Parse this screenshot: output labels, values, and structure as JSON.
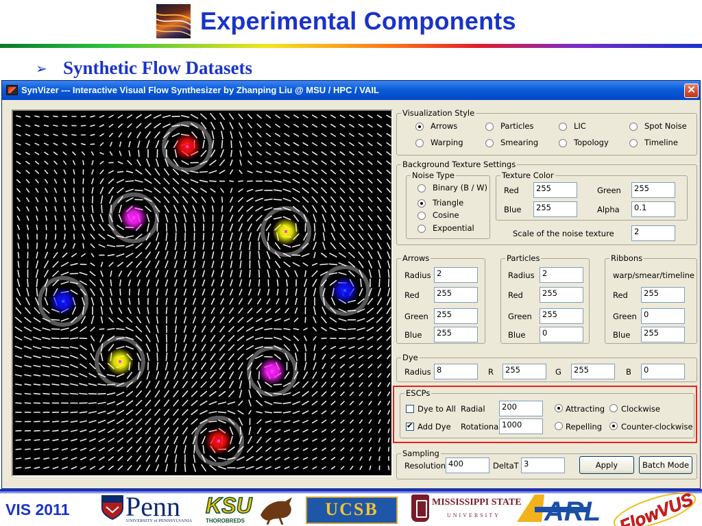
{
  "slide": {
    "title": "Experimental Components",
    "bullet_mark": "➢",
    "bullet_text": "Synthetic Flow Datasets",
    "footer_label": "VIS 2011"
  },
  "window": {
    "title": "SynVizer --- Interactive Visual Flow Synthesizer by Zhanping Liu @ MSU / HPC / VAIL",
    "close_label": "✕"
  },
  "visualization_style": {
    "title": "Visualization Style",
    "options": [
      "Arrows",
      "Particles",
      "LIC",
      "Spot Noise",
      "Warping",
      "Smearing",
      "Topology",
      "Timeline"
    ],
    "selected": "Arrows"
  },
  "background_texture": {
    "title": "Background Texture Settings",
    "noise_type": {
      "title": "Noise Type",
      "options": [
        "Binary (B / W)",
        "Triangle",
        "Cosine",
        "Expoential"
      ],
      "selected": "Triangle"
    },
    "texture_color": {
      "title": "Texture Color",
      "red_label": "Red",
      "red": "255",
      "green_label": "Green",
      "green": "255",
      "blue_label": "Blue",
      "blue": "255",
      "alpha_label": "Alpha",
      "alpha": "0.1"
    },
    "scale_label": "Scale of the noise texture",
    "scale": "2"
  },
  "arrows": {
    "title": "Arrows",
    "radius_label": "Radius",
    "radius": "2",
    "red_label": "Red",
    "red": "255",
    "green_label": "Green",
    "green": "255",
    "blue_label": "Blue",
    "blue": "255"
  },
  "particles": {
    "title": "Particles",
    "radius_label": "Radius",
    "radius": "2",
    "red_label": "Red",
    "red": "255",
    "green_label": "Green",
    "green": "255",
    "blue_label": "Blue",
    "blue": "0"
  },
  "ribbons": {
    "title": "Ribbons",
    "subtitle": "warp/smear/timeline",
    "red_label": "Red",
    "red": "255",
    "green_label": "Green",
    "green": "0",
    "blue_label": "Blue",
    "blue": "255"
  },
  "dye": {
    "title": "Dye",
    "radius_label": "Radius",
    "radius": "8",
    "r_label": "R",
    "r": "255",
    "g_label": "G",
    "g": "255",
    "b_label": "B",
    "b": "0"
  },
  "escps": {
    "title": "ESCPs",
    "dye_to_all_label": "Dye to All",
    "dye_to_all": false,
    "add_dye_label": "Add Dye",
    "add_dye": true,
    "radial_label": "Radial",
    "radial": "200",
    "rotational_label": "Rotational",
    "rotational": "1000",
    "attracting_label": "Attracting",
    "repelling_label": "Repelling",
    "clockwise_label": "Clockwise",
    "counter_clockwise_label": "Counter-clockwise",
    "radial_mode": "Attracting",
    "rotation_mode": "Counter-clockwise",
    "highlight_color": "#e8211b"
  },
  "sampling": {
    "title": "Sampling",
    "resolution_label": "Resolution",
    "resolution": "400",
    "deltat_label": "DeltaT",
    "deltat": "3",
    "apply_label": "Apply",
    "batch_label": "Batch Mode"
  },
  "logos": {
    "penn": "Penn",
    "penn_sub": "UNIVERSITY of PENNSYLVANIA",
    "ksu": "KSU",
    "ksu_sub": "THOROBREDS",
    "ucsb": "UCSB",
    "msu_name": "MISSISSIPPI STATE",
    "msu_uni": "UNIVERSITY",
    "arl": "ARL",
    "flowvus": "FlowVUS"
  },
  "flow_field": {
    "critical_points": [
      {
        "color": "red"
      },
      {
        "color": "magenta"
      },
      {
        "color": "yellow"
      },
      {
        "color": "blue"
      },
      {
        "color": "blue"
      },
      {
        "color": "yellow"
      },
      {
        "color": "magenta"
      },
      {
        "color": "red"
      }
    ]
  },
  "colors": {
    "slide_blue": "#1a33c9",
    "titlebar_blue": "#0a5bd6",
    "window_bg": "#ece9d8"
  }
}
